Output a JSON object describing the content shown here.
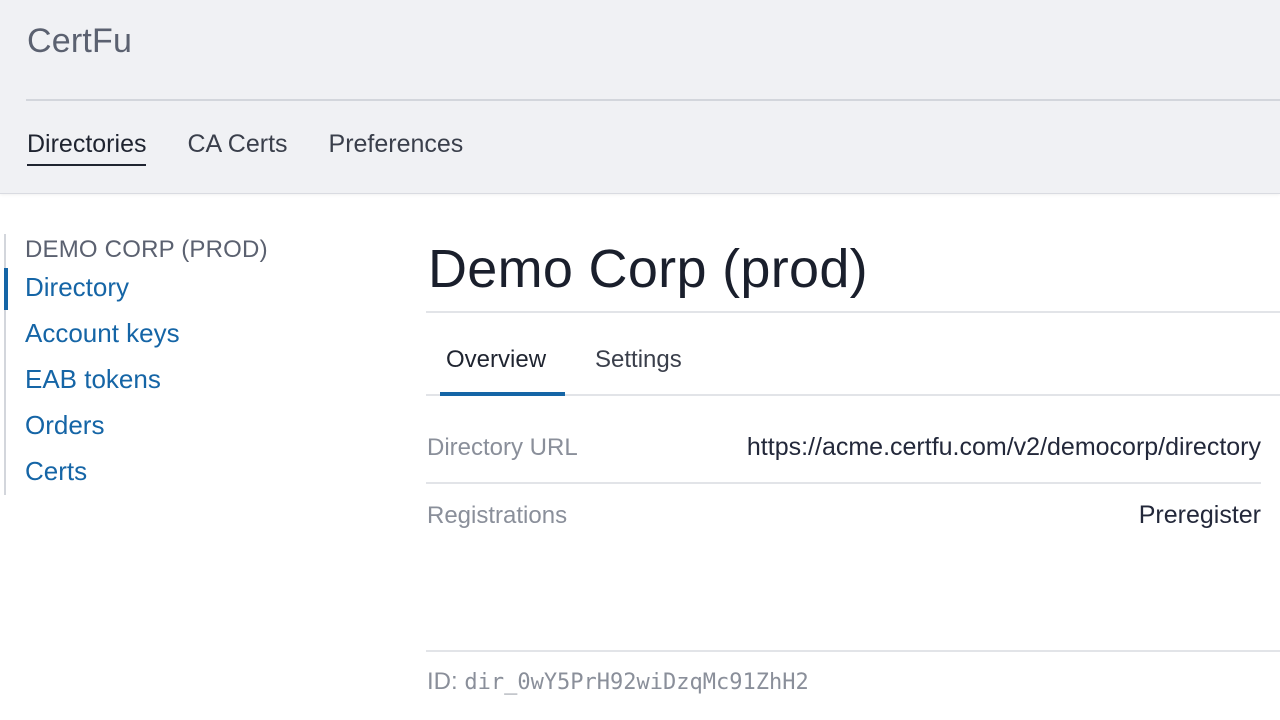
{
  "app": {
    "title": "CertFu"
  },
  "nav": {
    "items": [
      "Directories",
      "CA Certs",
      "Preferences"
    ],
    "active": "Directories"
  },
  "sidebar": {
    "heading": "DEMO CORP (PROD)",
    "items": [
      "Directory",
      "Account keys",
      "EAB tokens",
      "Orders",
      "Certs"
    ],
    "active": "Directory"
  },
  "main": {
    "title": "Demo Corp (prod)",
    "tabs": [
      "Overview",
      "Settings"
    ],
    "active_tab": "Overview",
    "rows": [
      {
        "label": "Directory URL",
        "value": "https://acme.certfu.com/v2/democorp/directory"
      },
      {
        "label": "Registrations",
        "value": "Preregister"
      }
    ],
    "id_prefix": "ID:",
    "id_value": "dir_0wY5PrH92wiDzqMc91ZhH2"
  },
  "colors": {
    "accent": "#1565a6",
    "header_bg": "#f0f1f4",
    "muted_text": "#8a8f9a"
  }
}
